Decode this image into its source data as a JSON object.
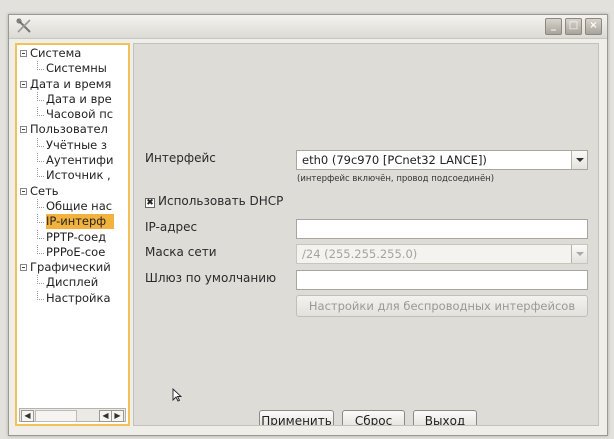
{
  "window": {
    "buttons": [
      "_",
      "□",
      "×"
    ]
  },
  "sidebar": {
    "items": [
      {
        "label": "Система",
        "level": 0,
        "expander": true
      },
      {
        "label": "Системны",
        "level": 1
      },
      {
        "label": "Дата и время",
        "level": 0,
        "expander": true
      },
      {
        "label": "Дата и вре",
        "level": 1
      },
      {
        "label": "Часовой пс",
        "level": 1
      },
      {
        "label": "Пользовател",
        "level": 0,
        "expander": true
      },
      {
        "label": "Учётные з",
        "level": 1
      },
      {
        "label": "Аутентифи",
        "level": 1
      },
      {
        "label": "Источник ,",
        "level": 1
      },
      {
        "label": "Сеть",
        "level": 0,
        "expander": true
      },
      {
        "label": "Общие нас",
        "level": 1
      },
      {
        "label": "IP-интерф",
        "level": 1,
        "selected": true
      },
      {
        "label": "PPTP-соед",
        "level": 1
      },
      {
        "label": "PPPoE-сое",
        "level": 1
      },
      {
        "label": "Графический",
        "level": 0,
        "expander": true
      },
      {
        "label": "Дисплей",
        "level": 1
      },
      {
        "label": "Настройка",
        "level": 1
      }
    ]
  },
  "form": {
    "interface_label": "Интерфейс",
    "interface_value": "eth0 (79c970 [PCnet32 LANCE])",
    "interface_hint": "(интерфейс включён, провод подсоединён)",
    "dhcp_label": "Использовать DHCP",
    "dhcp_checked_mark": "✖",
    "ip_label": "IP-адрес",
    "ip_value": "",
    "netmask_label": "Маска сети",
    "netmask_value": "/24 (255.255.255.0)",
    "gateway_label": "Шлюз по умолчанию",
    "gateway_value": "",
    "wireless_button": "Настройки для беспроводных интерфейсов"
  },
  "actions": {
    "apply": "Применить",
    "reset": "Сброс",
    "exit": "Выход"
  },
  "colors": {
    "selection": "#f2b23e",
    "sidebar_border": "#f0c25a"
  }
}
